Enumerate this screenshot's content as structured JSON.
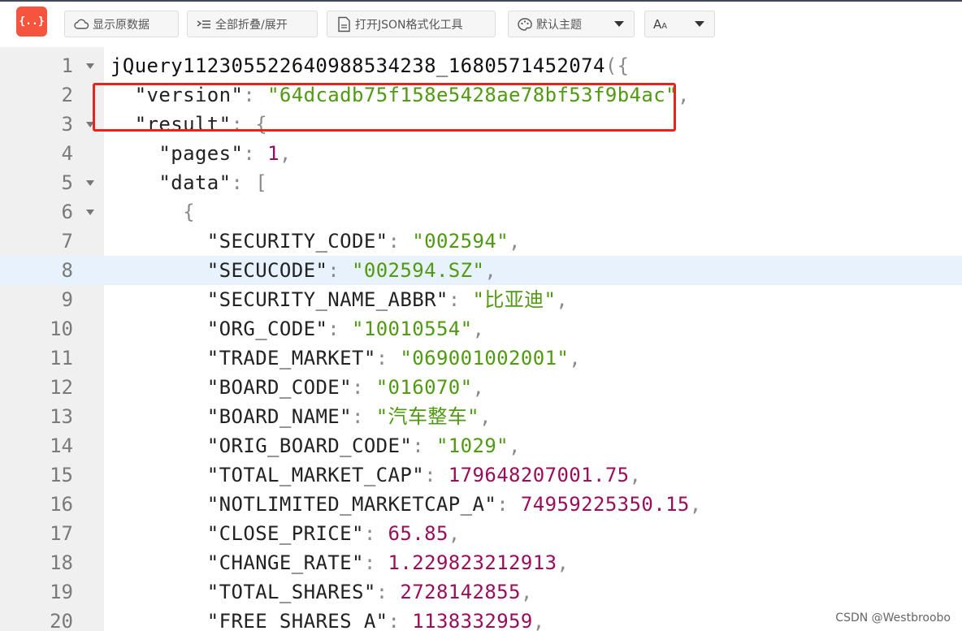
{
  "toolbar": {
    "logo_text": "{..}",
    "raw_label": "显示原数据",
    "fold_label": "全部折叠/展开",
    "open_label": "打开JSON格式化工具",
    "theme_label": "默认主题",
    "font_label": "A",
    "font_label_small": "A"
  },
  "colors": {
    "string": "#4f9a10",
    "number": "#9a0d5a",
    "highlight": "#e8241c",
    "logo": "#f5553f"
  },
  "editor": {
    "active_line": 8,
    "lines": [
      {
        "num": "1",
        "fold": true,
        "indent": "",
        "fn": "jQuery112305522640988534238_1680571452074",
        "tail": "({"
      },
      {
        "num": "2",
        "fold": false,
        "indent": "  ",
        "key": "\"version\"",
        "sep": ": ",
        "str": "\"64dcadb75f158e5428ae78bf53f9b4ac\"",
        "end": ","
      },
      {
        "num": "3",
        "fold": true,
        "indent": "  ",
        "key": "\"result\"",
        "sep": ": ",
        "end": "{"
      },
      {
        "num": "4",
        "fold": false,
        "indent": "    ",
        "key": "\"pages\"",
        "sep": ": ",
        "numval": "1",
        "end": ","
      },
      {
        "num": "5",
        "fold": true,
        "indent": "    ",
        "key": "\"data\"",
        "sep": ": ",
        "end": "["
      },
      {
        "num": "6",
        "fold": true,
        "indent": "      ",
        "end": "{"
      },
      {
        "num": "7",
        "fold": false,
        "indent": "        ",
        "key": "\"SECURITY_CODE\"",
        "sep": ": ",
        "str": "\"002594\"",
        "end": ","
      },
      {
        "num": "8",
        "fold": false,
        "indent": "        ",
        "key": "\"SECUCODE\"",
        "sep": ": ",
        "str": "\"002594.SZ\"",
        "end": ","
      },
      {
        "num": "9",
        "fold": false,
        "indent": "        ",
        "key": "\"SECURITY_NAME_ABBR\"",
        "sep": ": ",
        "str": "\"比亚迪\"",
        "end": ","
      },
      {
        "num": "10",
        "fold": false,
        "indent": "        ",
        "key": "\"ORG_CODE\"",
        "sep": ": ",
        "str": "\"10010554\"",
        "end": ","
      },
      {
        "num": "11",
        "fold": false,
        "indent": "        ",
        "key": "\"TRADE_MARKET\"",
        "sep": ": ",
        "str": "\"069001002001\"",
        "end": ","
      },
      {
        "num": "12",
        "fold": false,
        "indent": "        ",
        "key": "\"BOARD_CODE\"",
        "sep": ": ",
        "str": "\"016070\"",
        "end": ","
      },
      {
        "num": "13",
        "fold": false,
        "indent": "        ",
        "key": "\"BOARD_NAME\"",
        "sep": ": ",
        "str": "\"汽车整车\"",
        "end": ","
      },
      {
        "num": "14",
        "fold": false,
        "indent": "        ",
        "key": "\"ORIG_BOARD_CODE\"",
        "sep": ": ",
        "str": "\"1029\"",
        "end": ","
      },
      {
        "num": "15",
        "fold": false,
        "indent": "        ",
        "key": "\"TOTAL_MARKET_CAP\"",
        "sep": ": ",
        "numval": "179648207001.75",
        "end": ","
      },
      {
        "num": "16",
        "fold": false,
        "indent": "        ",
        "key": "\"NOTLIMITED_MARKETCAP_A\"",
        "sep": ": ",
        "numval": "74959225350.15",
        "end": ","
      },
      {
        "num": "17",
        "fold": false,
        "indent": "        ",
        "key": "\"CLOSE_PRICE\"",
        "sep": ": ",
        "numval": "65.85",
        "end": ","
      },
      {
        "num": "18",
        "fold": false,
        "indent": "        ",
        "key": "\"CHANGE_RATE\"",
        "sep": ": ",
        "numval": "1.229823212913",
        "end": ","
      },
      {
        "num": "19",
        "fold": false,
        "indent": "        ",
        "key": "\"TOTAL_SHARES\"",
        "sep": ": ",
        "numval": "2728142855",
        "end": ","
      },
      {
        "num": "20",
        "fold": false,
        "indent": "        ",
        "key": "\"FREE_SHARES_A\"",
        "sep": ": ",
        "numval": "1138332959",
        "end": ","
      }
    ]
  },
  "watermark": "CSDN @Westbroobo"
}
